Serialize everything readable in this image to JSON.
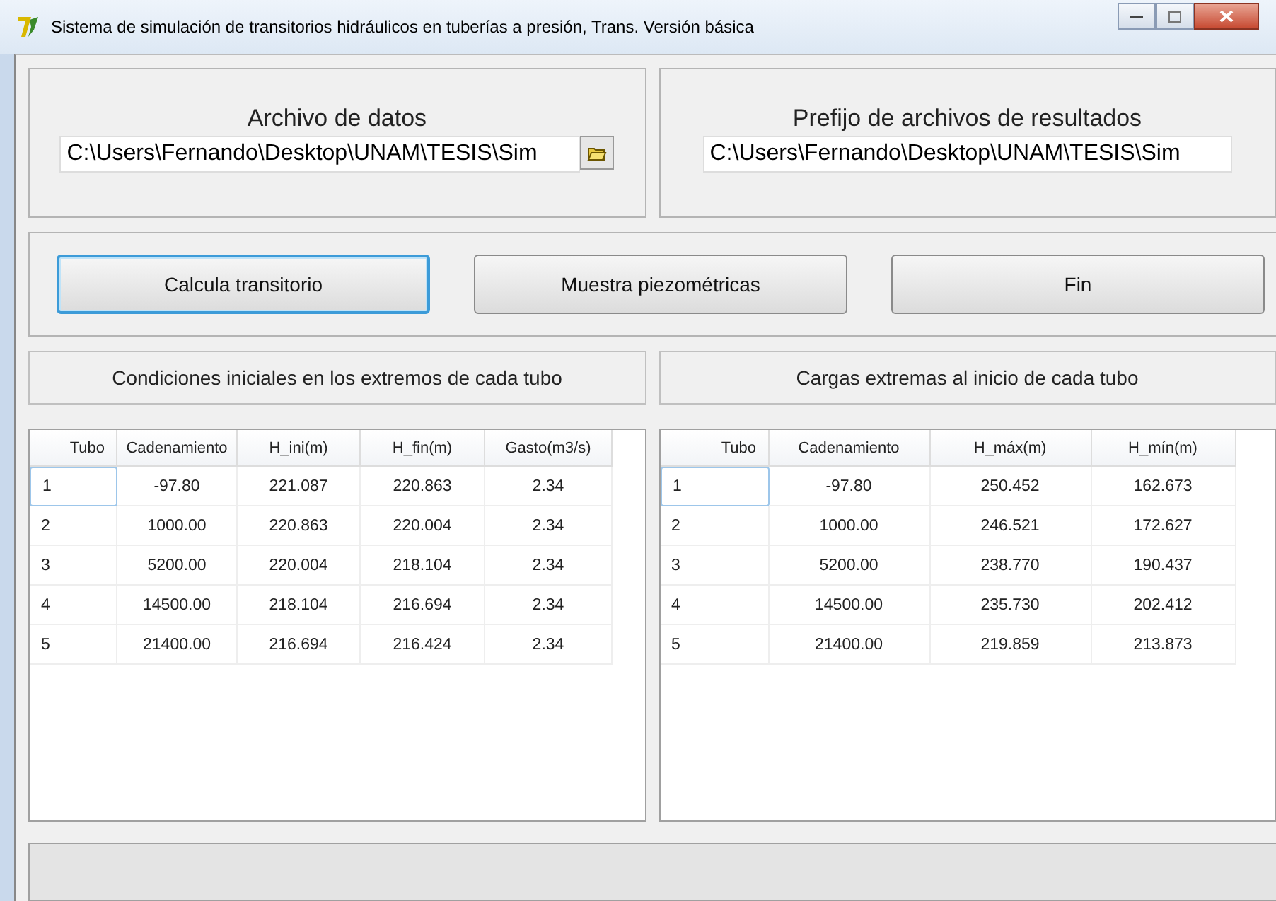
{
  "window": {
    "title": "Sistema de simulación de transitorios hidráulicos en tuberías a presión, Trans. Versión básica"
  },
  "data_file": {
    "label": "Archivo de datos",
    "value": "C:\\Users\\Fernando\\Desktop\\UNAM\\TESIS\\Sim"
  },
  "results_prefix": {
    "label": "Prefijo de archivos de resultados",
    "value": "C:\\Users\\Fernando\\Desktop\\UNAM\\TESIS\\Sim"
  },
  "buttons": [
    {
      "label": "Calcula transitorio",
      "focused": true
    },
    {
      "label": "Muestra piezométricas",
      "focused": false
    },
    {
      "label": "Fin",
      "focused": false
    }
  ],
  "tables": [
    {
      "title": "Condiciones iniciales en los extremos de cada tubo",
      "columns": [
        "Tubo",
        "Cadenamiento",
        "H_ini(m)",
        "H_fin(m)",
        "Gasto(m3/s)"
      ],
      "rows": [
        {
          "cells": [
            "1",
            "-97.80",
            "221.087",
            "220.863",
            "2.34"
          ],
          "selected": true
        },
        {
          "cells": [
            "2",
            "1000.00",
            "220.863",
            "220.004",
            "2.34"
          ],
          "selected": false
        },
        {
          "cells": [
            "3",
            "5200.00",
            "220.004",
            "218.104",
            "2.34"
          ],
          "selected": false
        },
        {
          "cells": [
            "4",
            "14500.00",
            "218.104",
            "216.694",
            "2.34"
          ],
          "selected": false
        },
        {
          "cells": [
            "5",
            "21400.00",
            "216.694",
            "216.424",
            "2.34"
          ],
          "selected": false
        }
      ]
    },
    {
      "title": "Cargas extremas al inicio de cada tubo",
      "columns": [
        "Tubo",
        "Cadenamiento",
        "H_máx(m)",
        "H_mín(m)"
      ],
      "rows": [
        {
          "cells": [
            "1",
            "-97.80",
            "250.452",
            "162.673"
          ],
          "selected": true
        },
        {
          "cells": [
            "2",
            "1000.00",
            "246.521",
            "172.627"
          ],
          "selected": false
        },
        {
          "cells": [
            "3",
            "5200.00",
            "238.770",
            "190.437"
          ],
          "selected": false
        },
        {
          "cells": [
            "4",
            "14500.00",
            "235.730",
            "202.412"
          ],
          "selected": false
        },
        {
          "cells": [
            "5",
            "21400.00",
            "219.859",
            "213.873"
          ],
          "selected": false
        }
      ]
    }
  ]
}
